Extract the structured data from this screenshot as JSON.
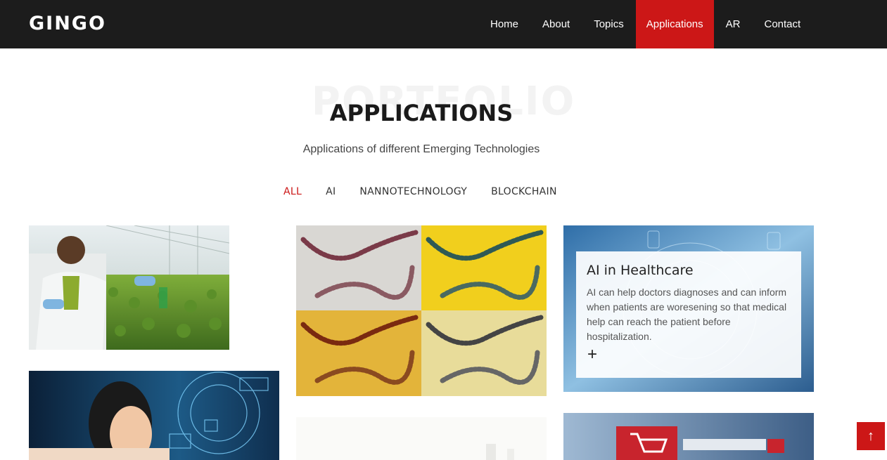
{
  "brand": {
    "logo": "GINGO"
  },
  "nav": {
    "items": [
      {
        "label": "Home"
      },
      {
        "label": "About"
      },
      {
        "label": "Topics"
      },
      {
        "label": "Applications"
      },
      {
        "label": "AR"
      },
      {
        "label": "Contact"
      }
    ],
    "active": "Applications"
  },
  "section": {
    "bg_title": "PORTFOLIO",
    "title": "APPLICATIONS",
    "subtitle": "Applications of different Emerging Technologies"
  },
  "filters": {
    "items": [
      {
        "label": "ALL"
      },
      {
        "label": "AI"
      },
      {
        "label": "NANNOTECHNOLOGY"
      },
      {
        "label": "BLOCKCHAIN"
      }
    ],
    "active": "ALL"
  },
  "portfolio": {
    "overlay": {
      "title": "AI in Healthcare",
      "text": "AI can help doctors diagnoses and can inform when patients are woresening so that medical help can reach the patient before hospitalization.",
      "plus": "+"
    }
  },
  "back_to_top": {
    "icon": "arrow-up-icon",
    "glyph": "↑"
  },
  "colors": {
    "accent": "#cc1717",
    "header_bg": "#1c1c1c"
  }
}
